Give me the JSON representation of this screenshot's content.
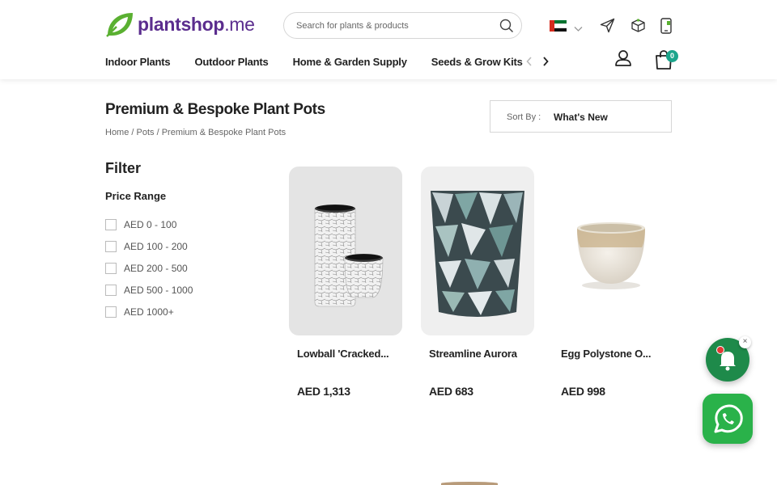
{
  "brand": {
    "name": "plantshop",
    "tld": ".me"
  },
  "search": {
    "placeholder": "Search for plants & products",
    "value": ""
  },
  "nav": {
    "items": [
      "Indoor Plants",
      "Outdoor Plants",
      "Home & Garden Supply",
      "Seeds & Grow Kits"
    ]
  },
  "cart": {
    "count": "0"
  },
  "page": {
    "title": "Premium & Bespoke Plant Pots"
  },
  "breadcrumb": {
    "items": [
      "Home",
      "Pots",
      "Premium & Bespoke Plant Pots"
    ],
    "separator": " / "
  },
  "sort": {
    "label": "Sort By :",
    "value": "What's New"
  },
  "filter": {
    "title": "Filter",
    "price_title": "Price Range",
    "ranges": [
      "AED 0 - 100",
      "AED 100 - 200",
      "AED 200 - 500",
      "AED 500 - 1000",
      "AED 1000+"
    ]
  },
  "products": [
    {
      "name": "Lowball 'Cracked...",
      "price": "AED 1,313"
    },
    {
      "name": "Streamline Aurora",
      "price": "AED 683"
    },
    {
      "name": "Egg Polystone O...",
      "price": "AED 998"
    }
  ],
  "widgets": {
    "close": "×"
  },
  "colors": {
    "brand_purple": "#5b2d8e",
    "brand_green": "#5ab031",
    "accent_teal": "#1ca58c",
    "whatsapp_green": "#2ab24a"
  },
  "icons": [
    "search-icon",
    "chevron-down-icon",
    "send-icon",
    "gift-box-icon",
    "mobile-app-icon",
    "chevron-left-icon",
    "chevron-right-icon",
    "user-icon",
    "shopping-bag-icon",
    "bell-icon",
    "whatsapp-icon"
  ]
}
